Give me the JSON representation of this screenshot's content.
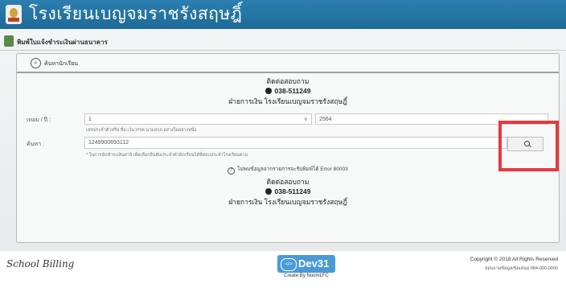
{
  "header": {
    "school_name": "โรงเรียนเบญจมราชรังสฤษฎิ์",
    "logo": "school-crest-icon"
  },
  "section": {
    "title": "พิมพ์ใบแจ้งชำระเงินผ่านธนาคาร",
    "icon": "money-icon"
  },
  "panel": {
    "heading": "ค้นหานักเรียน",
    "contact_top": {
      "title": "ติดต่อสอบถาม",
      "phone": "038-511249",
      "department": "ฝ่ายการเงิน โรงเรียนเบญจมราชรังสฤษฎิ์"
    },
    "term_label": "เทอม / ปี :",
    "term_value": "1",
    "year_value": "2564",
    "term_help": "เลขประจำตัวหรือ ชื่อ เว้นวรรค นามสกุล อย่างใดอย่างหนึ่ง",
    "search_label": "ค้นหา :",
    "search_value": "1249900693112",
    "search_help": "* ในการจ้บชำระเงินค่าจิ เพื่อเลือกยืนยันประจำตัวนักเรียนได้ที่สอบประจำโรงเรียนตาม",
    "notice": "ไม่พบข้อมูลจากรายการจะรับพิมพ์ได้ Error 80003",
    "contact_bottom": {
      "title": "ติดต่อสอบถาม",
      "phone": "038-511249",
      "department": "ฝ่ายการเงิน โรงเรียนเบญจมราชรังสฤษฎิ์"
    }
  },
  "footer": {
    "brand": "School Billing",
    "dev_logo": "Dev31",
    "dev_sub": "Create By NoomLFC",
    "copyright": "Copyright © 2018 All Rights Reserved",
    "contact": "สอบถามข้อมูล/ข้อเสนอ 084-000-0000"
  },
  "colors": {
    "header_bg": "#2c7fb0",
    "highlight": "#e8393f",
    "dev_logo": "#4a9ad6"
  }
}
